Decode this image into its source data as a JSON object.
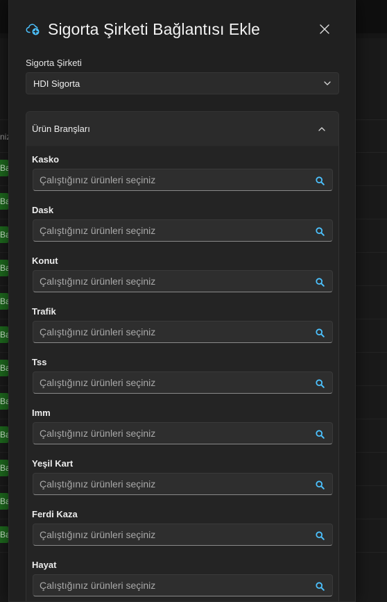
{
  "background": {
    "header_text": "niz",
    "badge_text": "Ba",
    "rows": 12
  },
  "modal": {
    "title": "Sigorta Şirketi Bağlantısı Ekle",
    "company_label": "Sigorta Şirketi",
    "company_value": "HDI Sigorta",
    "accordion_title": "Ürün Branşları",
    "input_placeholder": "Çalıştığınız ürünleri seçiniz",
    "branches": [
      {
        "label": "Kasko"
      },
      {
        "label": "Dask"
      },
      {
        "label": "Konut"
      },
      {
        "label": "Trafik"
      },
      {
        "label": "Tss"
      },
      {
        "label": "Imm"
      },
      {
        "label": "Yeşil Kart"
      },
      {
        "label": "Ferdi Kaza"
      },
      {
        "label": "Hayat"
      }
    ]
  },
  "colors": {
    "accent": "#4cc2ff",
    "badge": "#1e6b1e"
  },
  "icons": {
    "title": "cloud-add-icon",
    "close": "close-icon",
    "select": "chevron-down-icon",
    "accordion": "chevron-up-icon",
    "search": "search-icon"
  }
}
